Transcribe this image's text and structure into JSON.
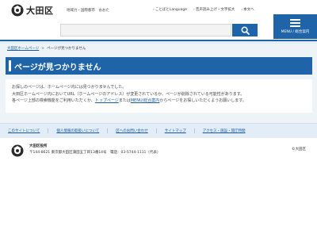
{
  "header": {
    "logo_text": "大田区",
    "tagline": "地域力・国際都市　おおた",
    "top_links": [
      "ことばとLanguage",
      "音声読み上げ・文字拡大",
      "本文へ"
    ],
    "search": {
      "placeholder": "",
      "button_icon": "search-icon"
    },
    "menu_label": "MENU / 総合案内"
  },
  "breadcrumb": {
    "home": "大田区ホームページ",
    "separator": ">",
    "current": "ページが見つかりません"
  },
  "main": {
    "title": "ページが見つかりません",
    "message": {
      "line1": "お探しのページは、ホームページ内には見つかりませんでした。",
      "line2": "大田区ホームページ内においてURL（ホームページのアドレス）が変更されているか、ページが削除されている可能性があります。",
      "line3_pre": "各ページ上部の検索機能をご利用いただくか、",
      "link_top": "トップページ",
      "line3_mid": "または",
      "link_menu": "MENU/総合案内",
      "line3_post": "からページをお探しいただくようお願いします。"
    }
  },
  "footer": {
    "links": [
      "このサイトについて",
      "個人情報の取扱いについて",
      "区へのお問い合わせ",
      "サイトマップ",
      "アクセス・施設・開庁時間"
    ],
    "office_name": "大田区役所",
    "address": "〒144-8621 東京都大田区蒲田五丁目13番14号　電話：03-5744-1111（代表）",
    "copyright": "©大田区"
  },
  "colors": {
    "primary": "#1f63a8",
    "band": "#e3edf7",
    "link": "#1a5aa0"
  }
}
